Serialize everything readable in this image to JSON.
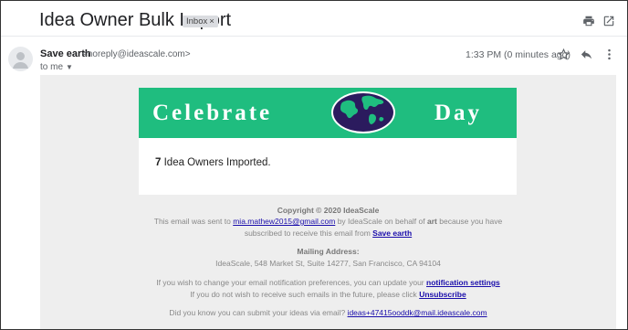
{
  "subject": "Idea Owner Bulk Import",
  "label": "Inbox",
  "label_close": "×",
  "sender": {
    "name": "Save earth",
    "email": "<noreply@ideascale.com>",
    "to": "to me"
  },
  "timestamp": "1:33 PM (0 minutes ago)",
  "banner": {
    "left_text": "Celebrate",
    "right_text": "Day"
  },
  "body": {
    "count": "7",
    "count_suffix": "Idea Owners Imported."
  },
  "footer": {
    "copyright": "Copyright © 2020 IdeaScale",
    "sent_prefix": "This email was sent to",
    "sent_email": "mia.mathew2015@gmail.com",
    "sent_mid": "by IdeaScale on behalf of",
    "sent_org": "art",
    "sent_suffix": "because you have",
    "subscribed_prefix": "subscribed to receive this email from",
    "subscribed_link": "Save earth",
    "mailing_label": "Mailing Address:",
    "mailing_address": "IdeaScale, 548 Market St, Suite 14277, San Francisco, CA 94104",
    "notif_prefix": "If you wish to change your email notification preferences, you can update your",
    "notif_link": "notification settings",
    "unsub_prefix": "If you do not wish to receive such emails in the future, please click",
    "unsub_link": "Unsubscribe",
    "submit_prefix": "Did you know you can submit your ideas via email?",
    "submit_email": "ideas+47415ooddk@mail.ideascale.com"
  },
  "colors": {
    "banner_bg": "#1fbd7f",
    "globe_color": "#2b1b5e",
    "link": "#1a0dab"
  },
  "icons": [
    "print-icon",
    "open-in-new-window-icon",
    "avatar-icon",
    "star-icon",
    "reply-icon",
    "more-vertical-icon",
    "globe-icon",
    "chevron-down-icon"
  ]
}
